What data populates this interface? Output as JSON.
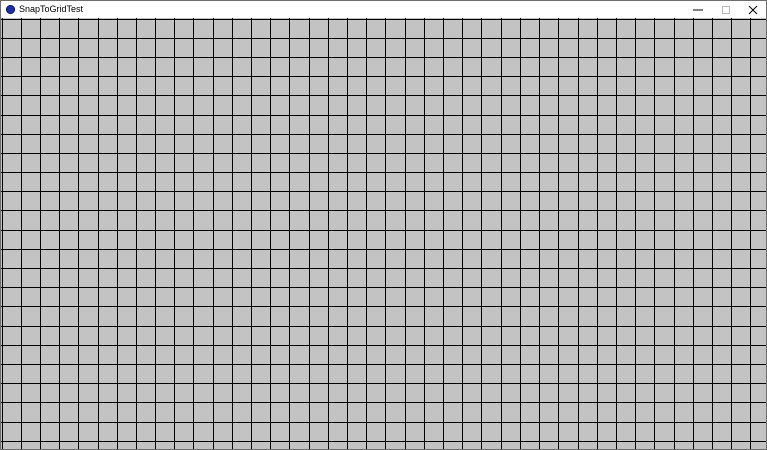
{
  "window": {
    "title": "SnapToGridTest",
    "icon": "app-circle-icon",
    "controls": {
      "minimize_icon": "minimize-icon",
      "maximize_icon": "maximize-icon",
      "close_icon": "close-icon"
    }
  },
  "grid": {
    "background_color": "#c3c3c3",
    "line_color": "#000000"
  }
}
